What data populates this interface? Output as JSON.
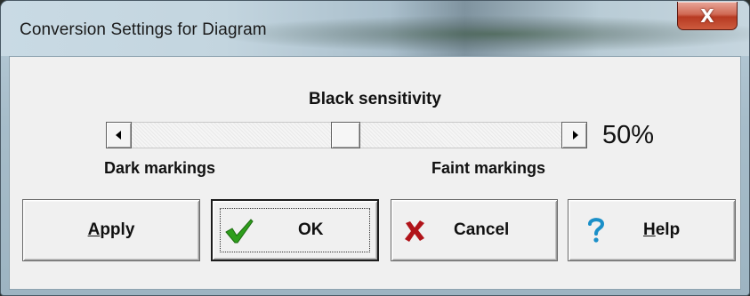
{
  "window": {
    "title": "Conversion Settings for Diagram",
    "close_glyph": "X"
  },
  "sensitivity": {
    "label": "Black sensitivity",
    "value_text": "50%",
    "level": 0.5,
    "left_label": "Dark markings",
    "right_label": "Faint markings"
  },
  "buttons": {
    "apply": {
      "mnemonic": "A",
      "rest": "pply"
    },
    "ok": {
      "label": "OK",
      "icon": "checkmark-icon"
    },
    "cancel": {
      "label": "Cancel",
      "icon": "red-x-icon"
    },
    "help": {
      "mnemonic": "H",
      "rest": "elp",
      "icon": "question-mark-icon"
    }
  },
  "colors": {
    "check": "#2e9e1c",
    "cancel_x": "#b1141a",
    "help_q": "#1a8fc8",
    "close_button": "#c94a33"
  }
}
